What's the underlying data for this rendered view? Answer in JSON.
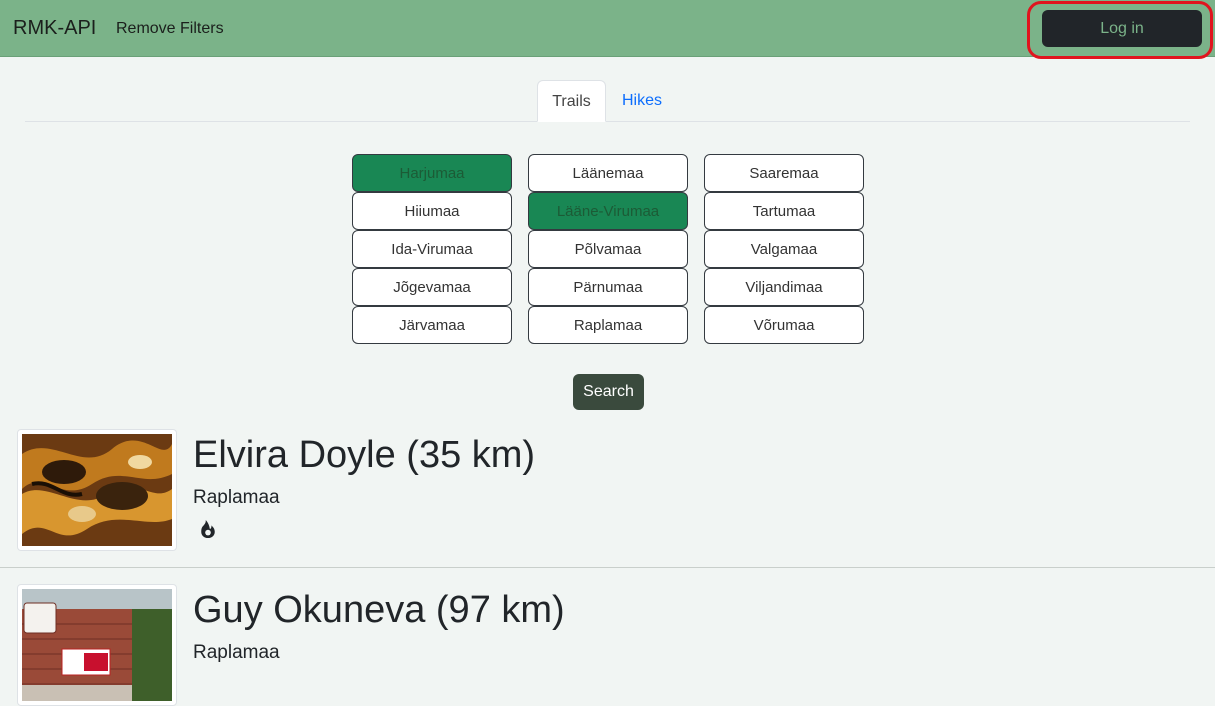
{
  "navbar": {
    "brand": "RMK-API",
    "remove_filters": "Remove Filters",
    "login": "Log in"
  },
  "tabs": [
    {
      "label": "Trails",
      "active": true
    },
    {
      "label": "Hikes",
      "active": false
    }
  ],
  "counties": [
    {
      "label": "Harjumaa",
      "selected": true
    },
    {
      "label": "Läänemaa",
      "selected": false
    },
    {
      "label": "Saaremaa",
      "selected": false
    },
    {
      "label": "Hiiumaa",
      "selected": false
    },
    {
      "label": "Lääne-Virumaa",
      "selected": true
    },
    {
      "label": "Tartumaa",
      "selected": false
    },
    {
      "label": "Ida-Virumaa",
      "selected": false
    },
    {
      "label": "Põlvamaa",
      "selected": false
    },
    {
      "label": "Valgamaa",
      "selected": false
    },
    {
      "label": "Jõgevamaa",
      "selected": false
    },
    {
      "label": "Pärnumaa",
      "selected": false
    },
    {
      "label": "Viljandimaa",
      "selected": false
    },
    {
      "label": "Järvamaa",
      "selected": false
    },
    {
      "label": "Raplamaa",
      "selected": false
    },
    {
      "label": "Võrumaa",
      "selected": false
    }
  ],
  "search_label": "Search",
  "trails": [
    {
      "title": "Elvira Doyle (35 km)",
      "county": "Raplamaa",
      "icon": "fire-icon"
    },
    {
      "title": "Guy Okuneva (97 km)",
      "county": "Raplamaa"
    }
  ],
  "colors": {
    "navbar": "#7bb389",
    "selected_county": "#198754",
    "highlight": "#e0141e"
  }
}
